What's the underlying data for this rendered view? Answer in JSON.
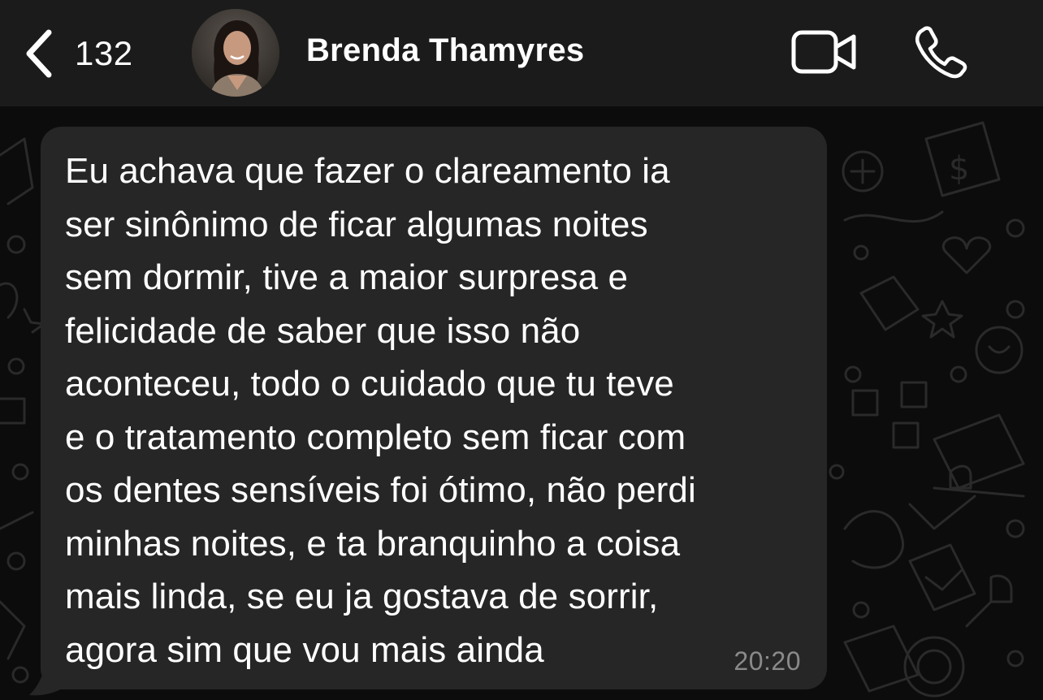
{
  "header": {
    "back_count": "132",
    "contact_name": "Brenda Thamyres",
    "icons": {
      "back": "chevron-left-icon",
      "video": "video-camera-icon",
      "phone": "phone-icon"
    }
  },
  "message": {
    "text": "Eu achava que fazer o clareamento ia\nser sinônimo de ficar algumas noites\nsem dormir, tive a maior surpresa e\nfelicidade de saber que isso não\naconteceu, todo o cuidado que tu teve\ne o tratamento completo sem ficar com\nos dentes sensíveis foi ótimo, não perdi\nminhas noites, e ta branquinho a coisa\nmais linda, se eu ja gostava de sorrir,\nagora sim que vou mais ainda",
    "time": "20:20"
  },
  "colors": {
    "header_bg": "#1b1b1b",
    "chat_bg": "#0c0c0c",
    "bubble_bg": "#262626",
    "text": "#ffffff",
    "timestamp": "#8a8a8a"
  }
}
